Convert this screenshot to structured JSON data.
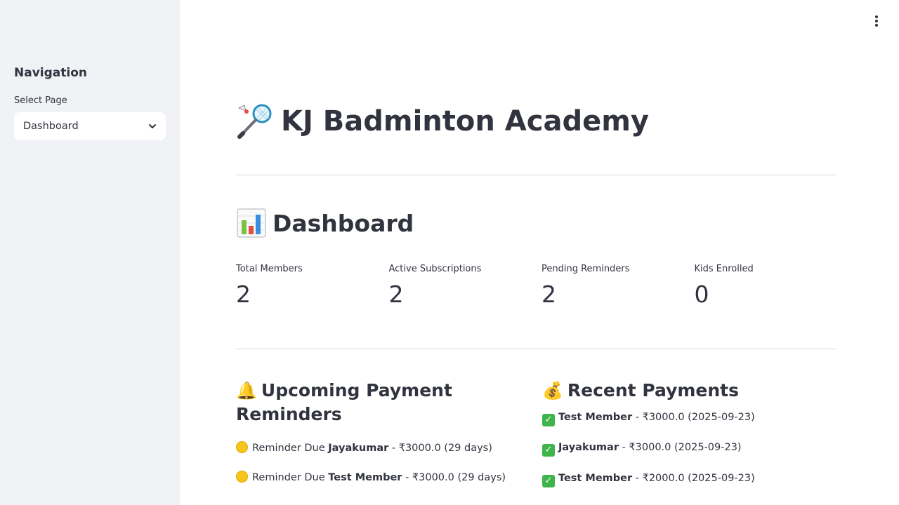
{
  "sidebar": {
    "heading": "Navigation",
    "select_label": "Select Page",
    "selected_page": "Dashboard"
  },
  "header": {
    "title": "KJ Badminton Academy"
  },
  "dashboard": {
    "title": "Dashboard",
    "metrics": [
      {
        "label": "Total Members",
        "value": "2"
      },
      {
        "label": "Active Subscriptions",
        "value": "2"
      },
      {
        "label": "Pending Reminders",
        "value": "2"
      },
      {
        "label": "Kids Enrolled",
        "value": "0"
      }
    ]
  },
  "reminders": {
    "title": "Upcoming Payment Reminders",
    "emoji": "🔔",
    "items": [
      {
        "prefix": "Reminder Due",
        "name": "Jayakumar",
        "detail": " - ₹3000.0 (29 days)"
      },
      {
        "prefix": "Reminder Due",
        "name": "Test Member",
        "detail": " - ₹3000.0 (29 days)"
      }
    ]
  },
  "payments": {
    "title": "Recent Payments",
    "emoji": "💰",
    "items": [
      {
        "name": "Test Member",
        "detail": " - ₹3000.0 (2025-09-23)"
      },
      {
        "name": "Jayakumar",
        "detail": " - ₹3000.0 (2025-09-23)"
      },
      {
        "name": "Test Member",
        "detail": " - ₹2000.0 (2025-09-23)"
      }
    ]
  }
}
